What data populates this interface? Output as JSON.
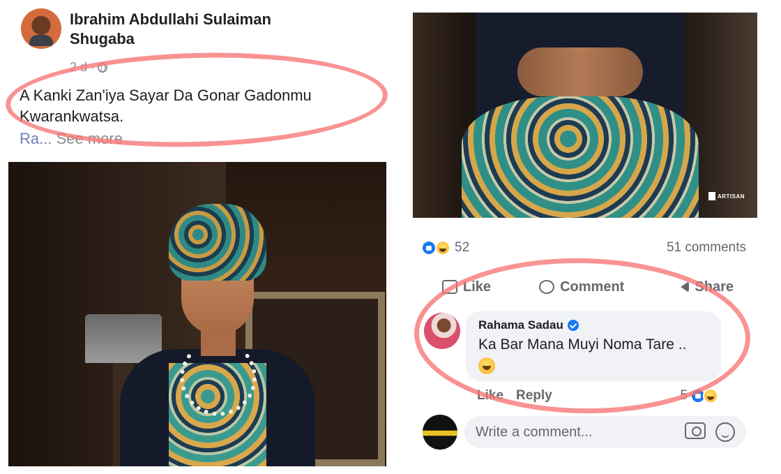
{
  "post": {
    "author_line1": "Ibrahim Abdullahi Sulaiman",
    "author_line2": "Shugaba",
    "time": "2 d ·",
    "text": "A Kanki Zan'iya Sayar Da Gonar Gadonmu Kwarankwatsa.",
    "truncated_prefix": "Ra...",
    "see_more": "See more"
  },
  "engagement": {
    "reaction_count": "52",
    "comments_count": "51 comments",
    "actions": {
      "like": "Like",
      "comment": "Comment",
      "share": "Share"
    }
  },
  "comment": {
    "author": "Rahama Sadau",
    "text": "Ka Bar Mana Muyi Noma Tare ..",
    "like_label": "Like",
    "reply_label": "Reply",
    "reaction_count": "5"
  },
  "composer": {
    "placeholder": "Write a comment..."
  },
  "watermark": {
    "text": "ARTISAN"
  },
  "colors": {
    "highlight": "#f77474",
    "facebook_blue": "#1877f2",
    "muted_text": "#65676b"
  }
}
